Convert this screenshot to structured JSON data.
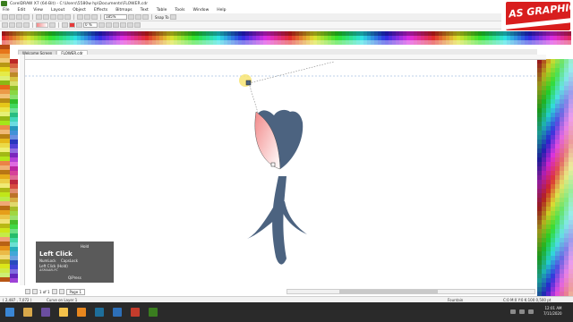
{
  "window": {
    "title": "CorelDRAW X7 (64-Bit) - C:\\Users\\5580w hp\\Documents\\FLOWER.cdr"
  },
  "menubar": [
    "File",
    "Edit",
    "View",
    "Layout",
    "Object",
    "Effects",
    "Bitmaps",
    "Text",
    "Table",
    "Tools",
    "Window",
    "Help"
  ],
  "toolbar": {
    "zoom": "185%",
    "snap_to": "Snap To"
  },
  "property_bar": {
    "outline": "0 %"
  },
  "logo": {
    "text": "AS GRAPHICS"
  },
  "document_tabs": [
    "Welcome Screen",
    "FLOWER.cdr"
  ],
  "key_overlay": {
    "hold": "Hold",
    "action": "Left Click",
    "numlock": "NumLock",
    "capslock": "CapsLock",
    "held": "Left Click (Hold)",
    "user": "ASMAAN-PC",
    "brand": "QiPress"
  },
  "page_nav": {
    "position": "1 of 1",
    "page_tab": "Page 1"
  },
  "statusbar": {
    "coords": "( 2,487 , 7,072 )",
    "object_info": "Curve on Layer 1",
    "fill_type": "Fountain",
    "outline_info": "C:0 M:0 Y:0 K:100  0,500 pt"
  },
  "taskbar": {
    "time": "12:01 AM",
    "date": "7/11/2020"
  },
  "colors": {
    "flower": "#4c6380",
    "petal_gradient_start": "#f28a8a",
    "petal_gradient_end": "#ffffff",
    "logo_bg": "#d81e1e"
  }
}
